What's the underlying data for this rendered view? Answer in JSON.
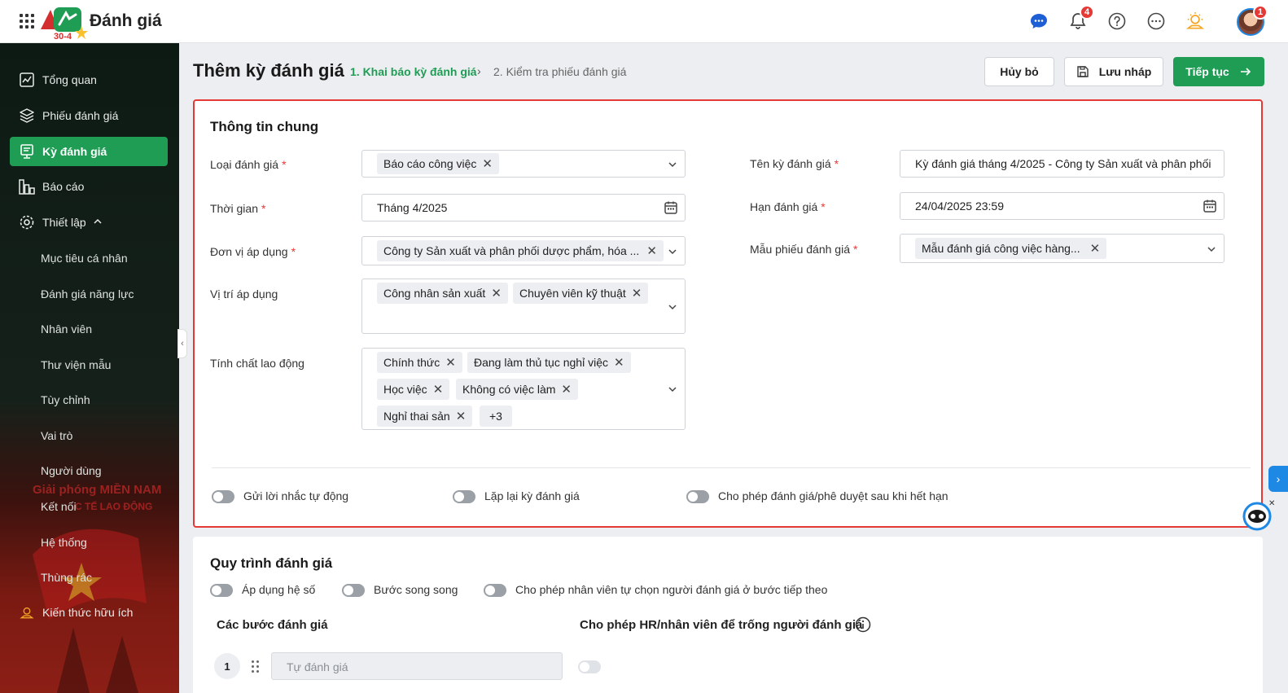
{
  "header": {
    "app_title": "Đánh giá",
    "logo_text": "30-4",
    "notification_count": "4",
    "avatar_badge": "1",
    "icons": [
      "apps-grid-icon",
      "chat-icon",
      "bell-icon",
      "help-icon",
      "more-icon",
      "lightbulb-icon"
    ]
  },
  "sidebar": {
    "items": [
      {
        "label": "Tổng quan",
        "icon": "chart-icon"
      },
      {
        "label": "Phiếu đánh giá",
        "icon": "layers-icon"
      },
      {
        "label": "Kỳ đánh giá",
        "icon": "clipboard-icon",
        "active": true
      },
      {
        "label": "Báo cáo",
        "icon": "bar-chart-icon"
      },
      {
        "label": "Thiết lập",
        "icon": "settings-icon",
        "expanded": true
      }
    ],
    "sub_items": [
      "Mục tiêu cá nhân",
      "Đánh giá năng lực",
      "Nhân viên",
      "Thư viện mẫu",
      "Tùy chỉnh",
      "Vai trò",
      "Người dùng",
      "Kết nối",
      "Hệ thống",
      "Thùng rác"
    ],
    "knowledge": {
      "label": "Kiến thức hữu ích",
      "icon": "lightbulb-icon"
    },
    "watermark": [
      "Giải phóng MIỀN NAM",
      "C TẾ LAO ĐỘNG"
    ]
  },
  "page": {
    "title": "Thêm kỳ đánh giá",
    "step1": "1. Khai báo kỳ đánh giá",
    "step_separator": "›",
    "step2": "2. Kiểm tra phiếu đánh giá",
    "cancel_label": "Hủy bỏ",
    "draft_label": "Lưu nháp",
    "continue_label": "Tiếp tục"
  },
  "general": {
    "title": "Thông tin chung",
    "required_mark": "*",
    "eval_type": {
      "label": "Loại đánh giá",
      "chips": [
        "Báo cáo công việc"
      ]
    },
    "time": {
      "label": "Thời gian",
      "value": "Tháng 4/2025"
    },
    "unit": {
      "label": "Đơn vị áp dụng",
      "chips": [
        "Công ty Sản xuất và phân phối dược phẩm, hóa ..."
      ]
    },
    "position": {
      "label": "Vị trí áp dụng",
      "chips": [
        "Công nhân sản xuất",
        "Chuyên viên kỹ thuật"
      ]
    },
    "labor": {
      "label": "Tính chất lao động",
      "chips": [
        "Chính thức",
        "Đang làm thủ tục nghỉ việc",
        "Học việc",
        "Không có việc làm",
        "Nghỉ thai sản"
      ],
      "more": "+3"
    },
    "period_name": {
      "label": "Tên kỳ đánh giá",
      "value": "Kỳ đánh giá tháng 4/2025 - Công ty Sản xuất và phân phối"
    },
    "deadline": {
      "label": "Hạn đánh giá",
      "value": "24/04/2025 23:59"
    },
    "template": {
      "label": "Mẫu phiếu đánh giá",
      "chips": [
        "Mẫu đánh giá công việc hàng..."
      ]
    },
    "toggles": [
      {
        "label": "Gửi lời nhắc tự động",
        "on": false
      },
      {
        "label": "Lặp lại kỳ đánh giá",
        "on": false
      },
      {
        "label": "Cho phép đánh giá/phê duyệt sau khi hết hạn",
        "on": false
      }
    ]
  },
  "process": {
    "title": "Quy trình đánh giá",
    "toggles": [
      {
        "label": "Áp dụng hệ số",
        "on": false
      },
      {
        "label": "Bước song song",
        "on": false
      },
      {
        "label": "Cho phép nhân viên tự chọn người đánh giá ở bước tiếp theo",
        "on": false
      }
    ],
    "steps_header": "Các bước đánh giá",
    "allow_empty_header": "Cho phép HR/nhân viên để trống người đánh giá",
    "steps": [
      {
        "number": "1",
        "name": "Tự đánh giá"
      }
    ]
  },
  "colors": {
    "brand_green": "#1f9d55",
    "highlight_red": "#e53935",
    "badge_red": "#e53935",
    "info_blue": "#1e88e5"
  }
}
